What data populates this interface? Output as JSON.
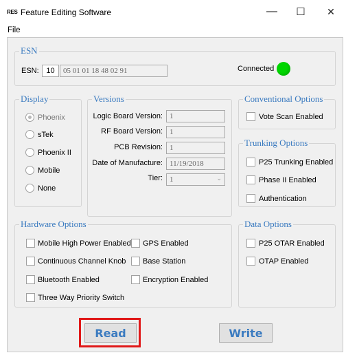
{
  "window": {
    "app_icon": "RES",
    "title": "Feature Editing Software",
    "minimize_icon": "—",
    "maximize_icon": "☐",
    "close_icon": "✕"
  },
  "menu": {
    "file": "File"
  },
  "esn": {
    "legend": "ESN",
    "label": "ESN:",
    "length": "10",
    "value": "05 01 01 18 48 02 91",
    "connected_label": "Connected",
    "connected_color": "#00d600"
  },
  "display": {
    "legend": "Display",
    "options": [
      "Phoenix",
      "sTek",
      "Phoenix II",
      "Mobile",
      "None"
    ],
    "selected": "Phoenix"
  },
  "versions": {
    "legend": "Versions",
    "logic_board_label": "Logic Board Version:",
    "logic_board_value": "1",
    "rf_board_label": "RF Board Version:",
    "rf_board_value": "1",
    "pcb_label": "PCB Revision:",
    "pcb_value": "1",
    "date_label": "Date of Manufacture:",
    "date_value": "11/19/2018",
    "tier_label": "Tier:",
    "tier_value": "1"
  },
  "conventional": {
    "legend": "Conventional Options",
    "vote_scan": "Vote Scan Enabled"
  },
  "trunking": {
    "legend": "Trunking Options",
    "p25_trunking": "P25 Trunking Enabled",
    "phase2": "Phase II Enabled",
    "authentication": "Authentication"
  },
  "hardware": {
    "legend": "Hardware Options",
    "mobile_high_power": "Mobile High Power Enabled",
    "gps": "GPS Enabled",
    "continuous_knob": "Continuous Channel Knob",
    "base_station": "Base Station",
    "bluetooth": "Bluetooth Enabled",
    "encryption": "Encryption Enabled",
    "three_way": "Three Way Priority Switch"
  },
  "data_options": {
    "legend": "Data Options",
    "p25_otar": "P25 OTAR Enabled",
    "otap": "OTAP Enabled"
  },
  "buttons": {
    "read": "Read",
    "write": "Write"
  },
  "colors": {
    "accent": "#3b7bc0",
    "highlight": "#e01818"
  }
}
